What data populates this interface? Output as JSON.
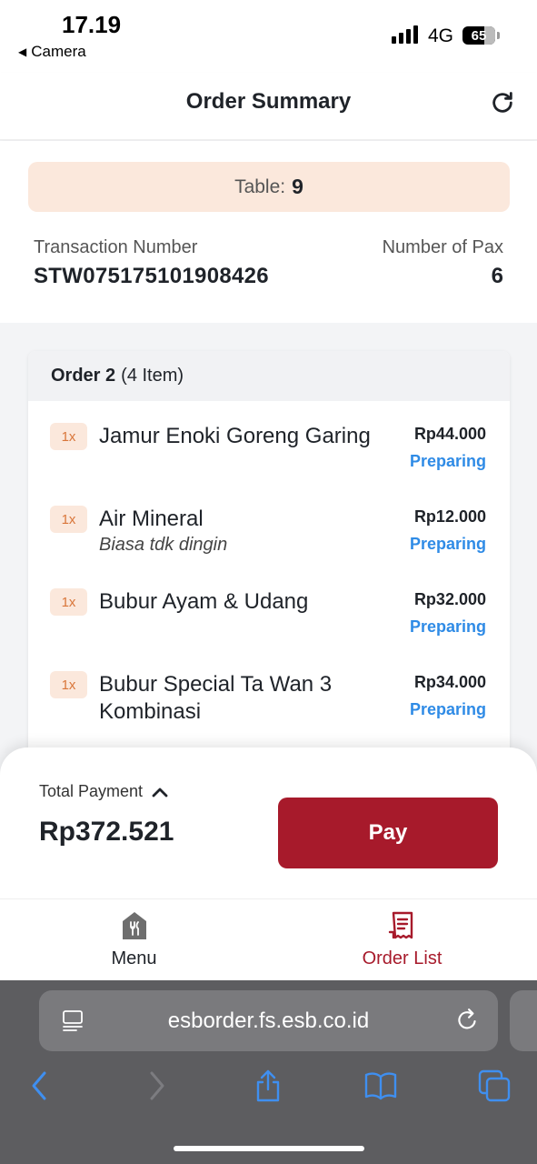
{
  "status_bar": {
    "time": "17.19",
    "back_label": "Camera",
    "network": "4G",
    "battery": "65"
  },
  "header": {
    "title": "Order Summary",
    "refresh_icon": "refresh-icon"
  },
  "info": {
    "table_label": "Table:",
    "table_number": "9",
    "transaction_label": "Transaction Number",
    "transaction_number": "STW07517510190842​6",
    "pax_label": "Number of Pax",
    "pax_value": "6"
  },
  "order": {
    "title": "Order 2",
    "count": "(4 Item)",
    "items": [
      {
        "qty": "1x",
        "name": "Jamur Enoki Goreng Garing",
        "note": "",
        "price": "Rp44.000",
        "status": "Preparing"
      },
      {
        "qty": "1x",
        "name": "Air Mineral",
        "note": "Biasa tdk dingin",
        "price": "Rp12.000",
        "status": "Preparing"
      },
      {
        "qty": "1x",
        "name": "Bubur Ayam & Udang",
        "note": "",
        "price": "Rp32.000",
        "status": "Preparing"
      },
      {
        "qty": "1x",
        "name": "Bubur Special Ta Wan 3 Kombinasi",
        "note": "",
        "price": "Rp34.000",
        "status": "Preparing"
      }
    ]
  },
  "payment": {
    "total_label": "Total Payment",
    "total_value": "Rp372.521",
    "pay_label": "Pay"
  },
  "nav": {
    "menu_label": "Menu",
    "order_list_label": "Order List",
    "active": "Order List",
    "active_color": "#a71a2b",
    "inactive_color": "#6e6e6e"
  },
  "browser": {
    "url": "esborder.fs.esb.co.id"
  },
  "colors": {
    "accent": "#a71a2b",
    "status_blue": "#2f8be6",
    "pill_bg": "#fbe8dc"
  }
}
